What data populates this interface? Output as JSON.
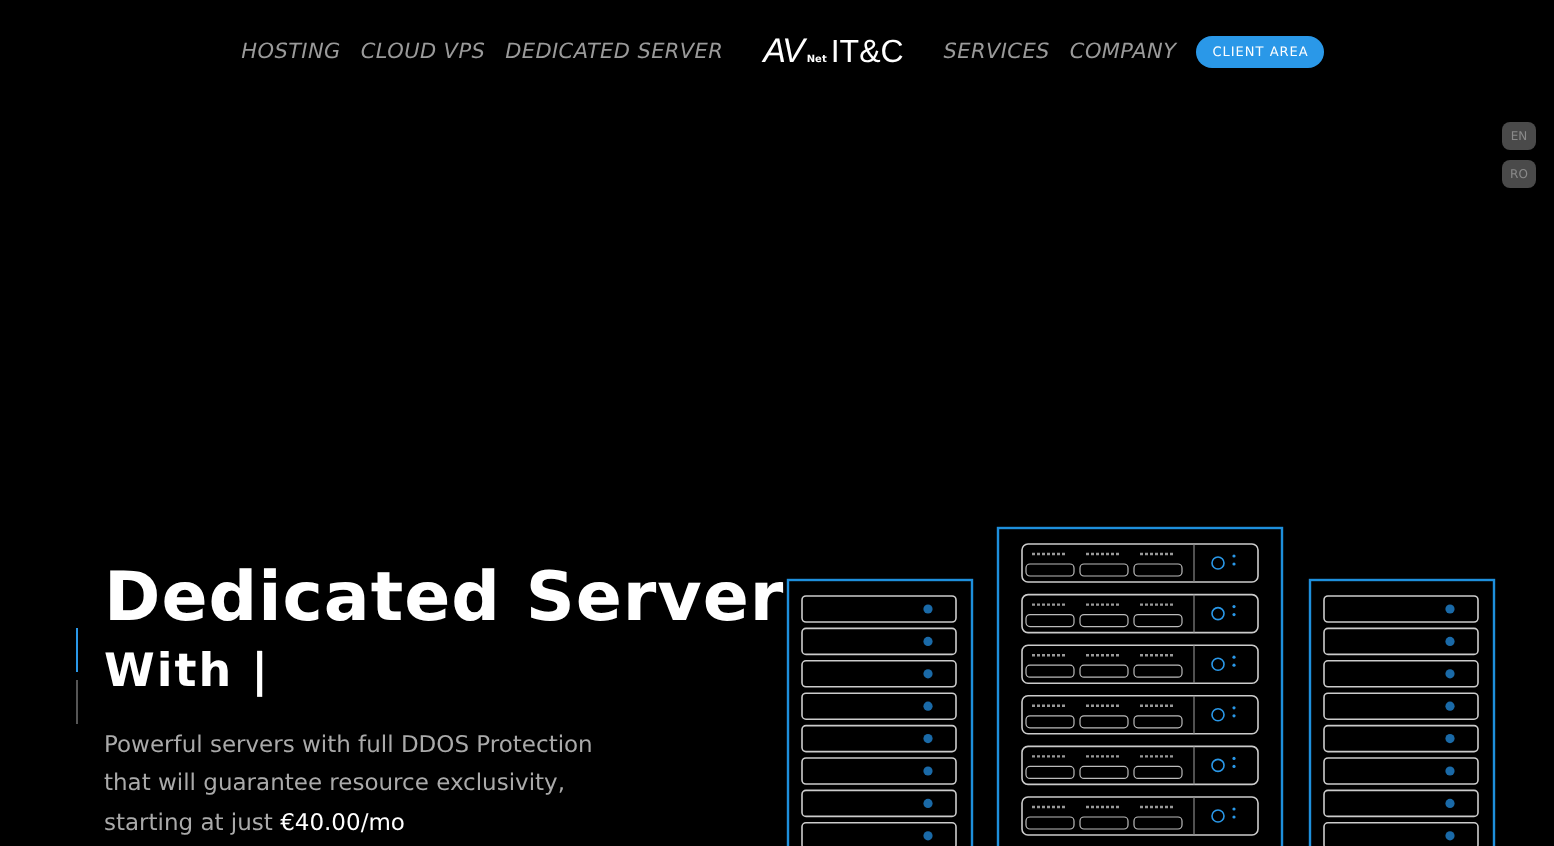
{
  "nav": {
    "left_links": [
      "HOSTING",
      "CLOUD VPS",
      "DEDICATED SERVER"
    ],
    "logo": {
      "mark": "AV",
      "small": "Net",
      "text": "IT&C"
    },
    "right_links": [
      "SERVICES",
      "COMPANY"
    ],
    "button": "CLIENT AREA"
  },
  "languages": [
    "EN",
    "RO"
  ],
  "hero": {
    "title": "Dedicated Server",
    "subtitle": "With |",
    "description": [
      "Powerful servers with full DDOS Protection",
      "that will guarantee resource exclusivity,",
      "starting at just **€40.00/mo**"
    ]
  }
}
